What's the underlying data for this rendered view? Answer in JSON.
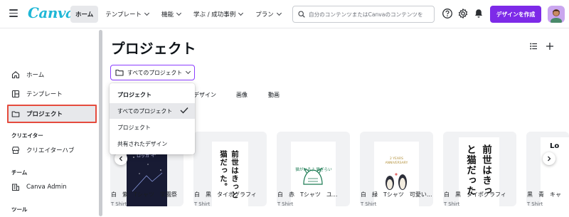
{
  "topbar": {
    "logo": "Canva",
    "nav": [
      {
        "label": "ホーム",
        "active": true
      },
      {
        "label": "テンプレート",
        "chevron": true
      },
      {
        "label": "機能",
        "chevron": true
      },
      {
        "label": "学ぶ / 成功事例",
        "chevron": true
      },
      {
        "label": "プラン",
        "chevron": true
      }
    ],
    "search_placeholder": "自分のコンテンツまたはCanvaのコンテンツを",
    "create_button": "デザインを作成",
    "icons": [
      "help-icon",
      "settings-icon",
      "notification-icon"
    ]
  },
  "sidebar": {
    "items_main": [
      {
        "label": "ホーム",
        "icon": "home-icon"
      },
      {
        "label": "テンプレート",
        "icon": "template-icon"
      },
      {
        "label": "プロジェクト",
        "icon": "folder-icon",
        "active": true
      }
    ],
    "section_creator": "クリエイター",
    "creator_items": [
      {
        "label": "クリエイターハブ",
        "icon": "shop-icon"
      }
    ],
    "section_team": "チーム",
    "team_items": [
      {
        "label": "Canva Admin",
        "icon": "building-icon"
      }
    ],
    "section_tools": "ツール"
  },
  "main": {
    "title": "プロジェクト",
    "filter_selected": "すべてのプロジェクト",
    "tabs": [
      "デザイン",
      "画像",
      "動画"
    ],
    "menu": {
      "heading": "プロジェクト",
      "options": [
        {
          "label": "すべてのプロジェクト",
          "selected": true
        },
        {
          "label": "プロジェクト"
        },
        {
          "label": "共有されたデザイン"
        }
      ]
    },
    "cards": [
      {
        "title": "白　紫　Tシャツ　学園祭",
        "sub": "T Shirt",
        "thumb_text": "ロッカ イ"
      },
      {
        "title": "白　黒　タイポグラフィ",
        "sub": "T Shirt",
        "thumb_text": "前世はきっと猫だった。"
      },
      {
        "title": "白　赤　Tシャツ　ユ...",
        "sub": "T Shirt",
        "thumb_text": "猫がいるよ 猫ぎらい"
      },
      {
        "title": "白　緑　Tシャツ　可愛い...",
        "sub": "T Shirt",
        "thumb_text": "2 YEARS ANNIVERSARY"
      },
      {
        "title": "白　黒　タイポグラフィ",
        "sub": "T Shirt",
        "thumb_text": "前世はきっと猫だった"
      },
      {
        "title": "黒　青　キャ",
        "sub": "T Shirt",
        "thumb_text": "Lo"
      }
    ]
  },
  "colors": {
    "accent": "#7d2ae8",
    "highlight_border": "#e54b3d",
    "logo": "#1fb7d6"
  }
}
